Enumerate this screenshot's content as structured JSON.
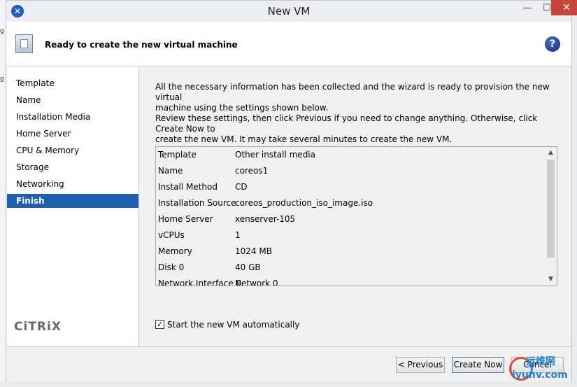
{
  "window": {
    "title": "New VM",
    "minimize_glyph": "—",
    "maximize_glyph": "☐",
    "close_glyph": "✕"
  },
  "header": {
    "title": "Ready to create the new virtual machine",
    "help_glyph": "?"
  },
  "steps": [
    {
      "label": "Template",
      "active": false
    },
    {
      "label": "Name",
      "active": false
    },
    {
      "label": "Installation Media",
      "active": false
    },
    {
      "label": "Home Server",
      "active": false
    },
    {
      "label": "CPU & Memory",
      "active": false
    },
    {
      "label": "Storage",
      "active": false
    },
    {
      "label": "Networking",
      "active": false
    },
    {
      "label": "Finish",
      "active": true
    }
  ],
  "brand": {
    "logo_text": "CiTRiX"
  },
  "intro": {
    "line1": "All the necessary information has been collected and the wizard is ready to provision the new virtual",
    "line2": "machine using the settings shown below.",
    "line3": "Review these settings, then click Previous if you need to change anything. Otherwise, click Create Now to",
    "line4": "create the new VM. It may take several minutes to create the new VM."
  },
  "summary": [
    {
      "key": "Template",
      "value": "Other install media"
    },
    {
      "key": "Name",
      "value": "coreos1"
    },
    {
      "key": "Install Method",
      "value": "CD"
    },
    {
      "key": "Installation Source",
      "value": "coreos_production_iso_image.iso"
    },
    {
      "key": "Home Server",
      "value": "xenserver-105"
    },
    {
      "key": "vCPUs",
      "value": "1"
    },
    {
      "key": "Memory",
      "value": "1024 MB"
    },
    {
      "key": "Disk 0",
      "value": "40 GB"
    },
    {
      "key": "Network Interface 0",
      "value": "Network 0"
    }
  ],
  "auto_start": {
    "label": "Start the new VM automatically",
    "checked": true,
    "check_glyph": "✓"
  },
  "buttons": {
    "previous": "< Previous",
    "create_now": "Create Now",
    "cancel": "Cancel"
  },
  "watermark": {
    "text": "运维网",
    "sub": "iyunv.com"
  }
}
